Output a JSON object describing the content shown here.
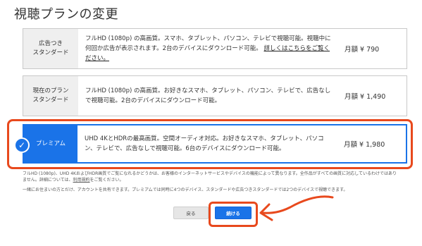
{
  "page": {
    "title": "視聴プランの変更"
  },
  "plans": [
    {
      "name_line1": "広告つき",
      "name_line2": "スタンダード",
      "description": "フルHD (1080p) の高画質。スマホ、タブレット、パソコン、テレビで視聴可能。視聴中に何回か広告が表示されます。2台のデバイスにダウンロード可能。",
      "link_text": "詳しくはこちらをご覧ください。",
      "price": "月額 ¥ 790",
      "selected": false
    },
    {
      "name_line1": "現在のプラン",
      "name_line2": "スタンダード",
      "description": "フルHD (1080p) の高画質。お好きなスマホ、タブレット、パソコン、テレビで、広告なしで視聴可能。2台のデバイスにダウンロード可能。",
      "price": "月額 ¥ 1,490",
      "selected": false
    },
    {
      "name_line1": "プレミアム",
      "description": "UHD 4KとHDRの最高画質。空間オーディオ対応。お好きなスマホ、タブレット、パソコン、テレビで、広告なしで視聴可能。6台のデバイスにダウンロード可能。",
      "price": "月額 ¥ 1,980",
      "selected": true
    }
  ],
  "notes": {
    "note1_text": "フルHD (1080p)、UHD 4KおよびHDR画質でご覧になれるかどうかは、お客様のインターネットサービスやデバイスの機能によって異なります。全作品がすべての画質に対応しているわけではありません。詳細については、",
    "note1_link": "利用規約",
    "note1_tail": "をご覧ください。",
    "note2_text": "一緒にお住まいの方とだけ、アカウントを共有できます。プレミアムでは同時に4つのデバイス、スタンダードや広告つきスタンダードでは2つのデバイスで視聴できます。"
  },
  "buttons": {
    "back_label": "戻る",
    "continue_label": "続ける"
  },
  "colors": {
    "accent": "#1a73e8",
    "annotation": "#e8491d"
  },
  "icons": {
    "selected": "check-icon",
    "annotation": "arrow-icon"
  }
}
